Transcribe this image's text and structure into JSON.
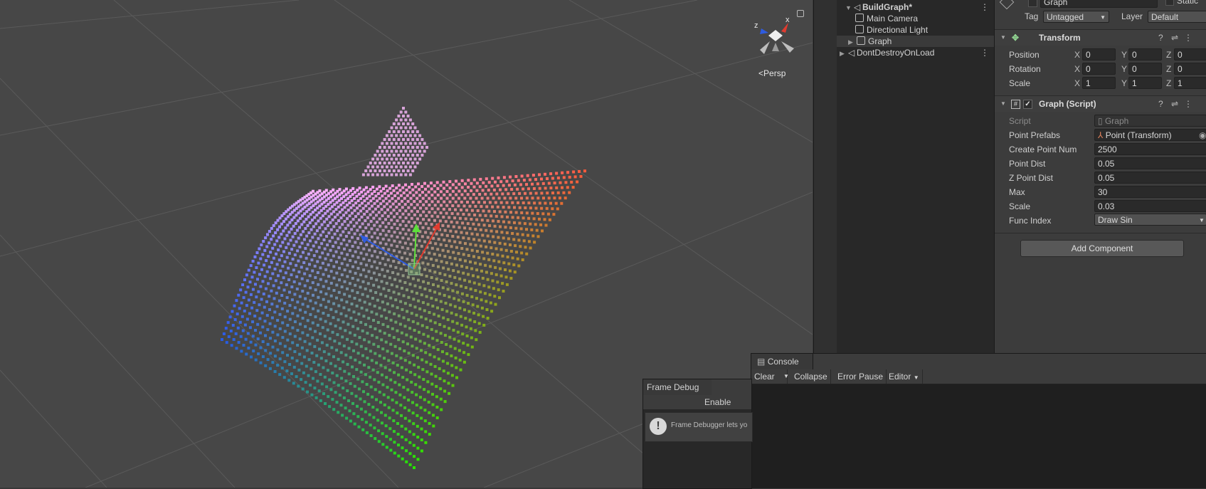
{
  "scene": {
    "projection_label": "Persp",
    "gizmo_axes": {
      "x": "x",
      "z": "z"
    }
  },
  "hierarchy": {
    "items": [
      {
        "label": "BuildGraph*",
        "level": 0,
        "expanded": true
      },
      {
        "label": "Main Camera",
        "level": 1
      },
      {
        "label": "Directional Light",
        "level": 1
      },
      {
        "label": "Graph",
        "level": 1,
        "selected": true
      },
      {
        "label": "DontDestroyOnLoad",
        "level": 0,
        "expanded": false
      }
    ]
  },
  "inspector": {
    "object_name": "Graph",
    "static_label": "Static",
    "tag_label": "Tag",
    "tag_value": "Untagged",
    "layer_label": "Layer",
    "layer_value": "Default",
    "transform": {
      "title": "Transform",
      "rows": [
        {
          "label": "Position",
          "x": "0",
          "y": "0",
          "z": "0"
        },
        {
          "label": "Rotation",
          "x": "0",
          "y": "0",
          "z": "0"
        },
        {
          "label": "Scale",
          "x": "1",
          "y": "1",
          "z": "1"
        }
      ],
      "axis_labels": {
        "x": "X",
        "y": "Y",
        "z": "Z"
      }
    },
    "script_component": {
      "title": "Graph (Script)",
      "script_label": "Script",
      "script_value": "Graph",
      "fields": [
        {
          "label": "Point Prefabs",
          "value": "Point (Transform)"
        },
        {
          "label": "Create Point Num",
          "value": "2500"
        },
        {
          "label": "Point Dist",
          "value": "0.05"
        },
        {
          "label": "Z Point Dist",
          "value": "0.05"
        },
        {
          "label": "Max",
          "value": "30"
        },
        {
          "label": "Scale",
          "value": "0.03"
        },
        {
          "label": "Func Index",
          "value": "Draw Sin"
        }
      ]
    },
    "add_component_label": "Add Component"
  },
  "console": {
    "tab_label": "Console",
    "toolbar": {
      "clear": "Clear",
      "collapse": "Collapse",
      "error_pause": "Error Pause",
      "editor": "Editor"
    }
  },
  "frame_debug": {
    "tab_label": "Frame Debug",
    "enable_label": "Enable",
    "help_text": "Frame Debugger lets yo"
  }
}
